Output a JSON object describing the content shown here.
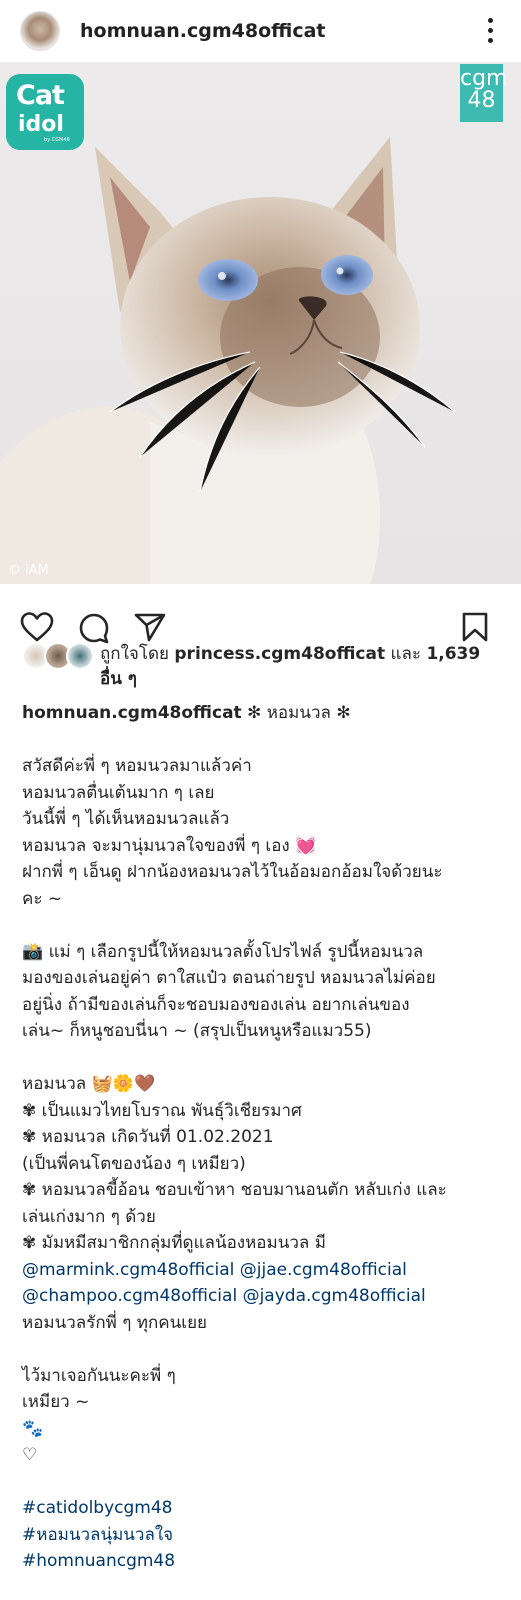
{
  "post": {
    "username": "homnuan.cgm48officat"
  },
  "photo": {
    "brand_logo_line1": "Cat",
    "brand_logo_line2": "idol",
    "brand_logo_sub": "by CGM48",
    "cgm_logo_line1": "cgm",
    "cgm_logo_line2": "48",
    "credit": "© iAM"
  },
  "likes": {
    "prefix": "ถูกใจโดย",
    "user": "princess.cgm48officat",
    "conjunction": "และ",
    "count": "1,639",
    "suffix": "อื่น ๆ"
  },
  "caption": {
    "username": "homnuan.cgm48officat",
    "title": "✻ หอมนวล ✻",
    "greeting": [
      "สวัสดีค่ะพี่ ๆ หอมนวลมาแล้วค่า",
      "หอมนวลตื่นเต้นมาก ๆ เลย",
      "วันนี้พี่ ๆ ได้เห็นหอมนวลแล้ว"
    ],
    "line_heart_text": "หอมนวล จะมานุ่มนวลใจของพี่ ๆ เอง",
    "line_heart_emoji": "💓",
    "line_ending": "ฝากพี่ ๆ เอ็นดู ฝากน้องหอมนวลไว้ในอ้อมอกอ้อมใจด้วยนะ\nคะ ~",
    "photo_note": [
      "📸 แม่ ๆ เลือกรูปนี้ให้หอมนวลตั้งโปรไฟล์ รูปนี้หอมนวล",
      "มองของเล่นอยู่ค่า ตาใสแป๋ว ตอนถ่ายรูป หอมนวลไม่ค่อย",
      "อยู่นิ่ง ถ้ามีของเล่นก็จะชอบมองของเล่น อยากเล่นของ",
      "เล่น~ ก็หนูชอบนี่นา ~ (สรุปเป็นหนูหรือแมว55)"
    ],
    "profile_name_line": "หอมนวล 🧺🌼🤎",
    "profile": [
      "✾ เป็นแมวไทยโบราณ พันธุ์วิเชียรมาศ",
      "✾ หอมนวล เกิดวันที่ 01.02.2021",
      "(เป็นพี่คนโตของน้อง ๆ เหมียว)",
      "✾ หอมนวลขี้อ้อน ชอบเข้าหา ชอบมานอนตัก หลับเก่ง และ",
      "เล่นเก่งมาก ๆ ด้วย",
      "✾ มัมหมีสมาชิกกลุ่มที่ดูแลน้องหอมนวล มี"
    ],
    "mentions_line1": "@marmink.cgm48official @jjae.cgm48official",
    "mentions_line2": "@champoo.cgm48official @jayda.cgm48official",
    "love_line": "หอมนวลรักพี่ ๆ ทุกคนเยย",
    "closing": [
      "ไว้มาเจอกันนะคะพี่ ๆ",
      "เหมียว ~",
      "🐾",
      "♡"
    ],
    "hashtags": [
      "#catidolbycgm48",
      "#หอมนวลนุ่มนวลใจ",
      "#homnuancgm48"
    ]
  },
  "icons": {
    "heart": "heart-icon",
    "comment": "comment-icon",
    "share": "share-icon",
    "save": "bookmark-icon",
    "more": "more-icon"
  },
  "colors": {
    "link": "#00376b",
    "text": "#262626",
    "brand_teal": "#26b4a5"
  }
}
